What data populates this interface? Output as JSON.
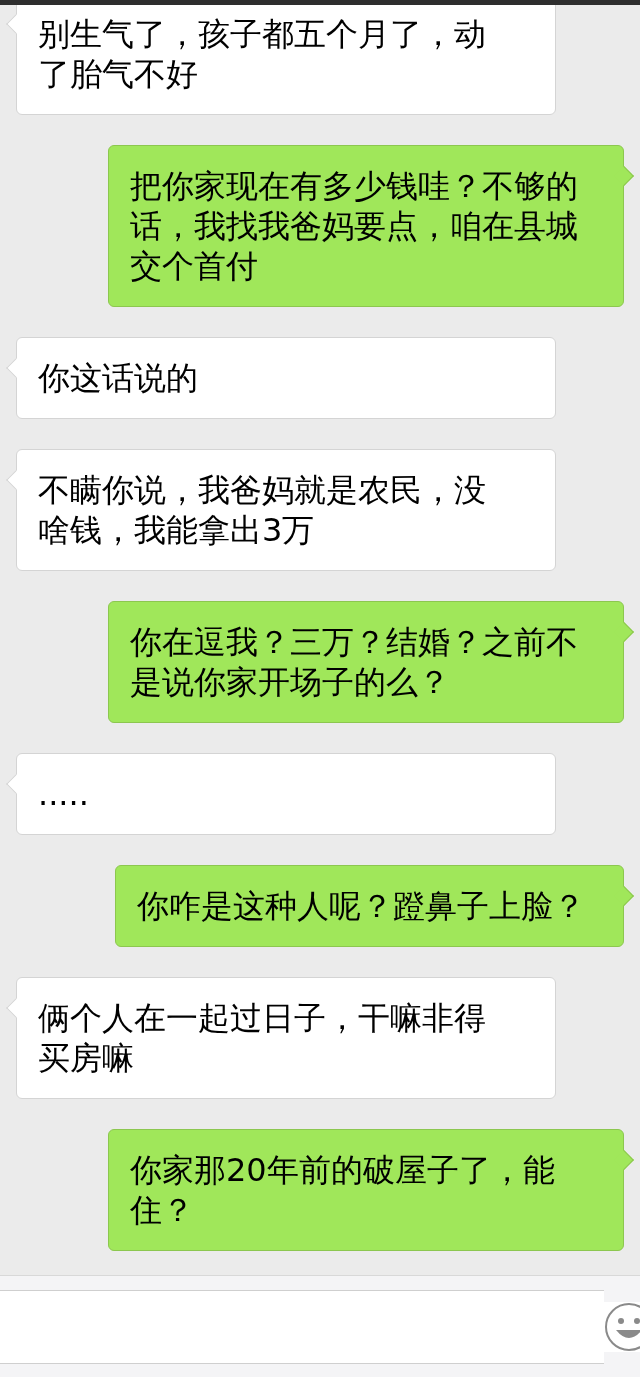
{
  "messages": [
    {
      "kind": "received",
      "text": "别生气了，孩子都五个月了，动了胎气不好"
    },
    {
      "kind": "sent",
      "text": "把你家现在有多少钱哇？不够的话，我找我爸妈要点，咱在县城交个首付"
    },
    {
      "kind": "received",
      "text": "你这话说的"
    },
    {
      "kind": "received",
      "text": "不瞒你说，我爸妈就是农民，没啥钱，我能拿出3万"
    },
    {
      "kind": "sent",
      "text": "你在逗我？三万？结婚？之前不是说你家开场子的么？"
    },
    {
      "kind": "received",
      "text": "....."
    },
    {
      "kind": "sent",
      "text": "你咋是这种人呢？蹬鼻子上脸？"
    },
    {
      "kind": "received",
      "text": "俩个人在一起过日子，干嘛非得买房嘛"
    },
    {
      "kind": "sent",
      "text": "你家那20年前的破屋子了，能住？"
    }
  ]
}
